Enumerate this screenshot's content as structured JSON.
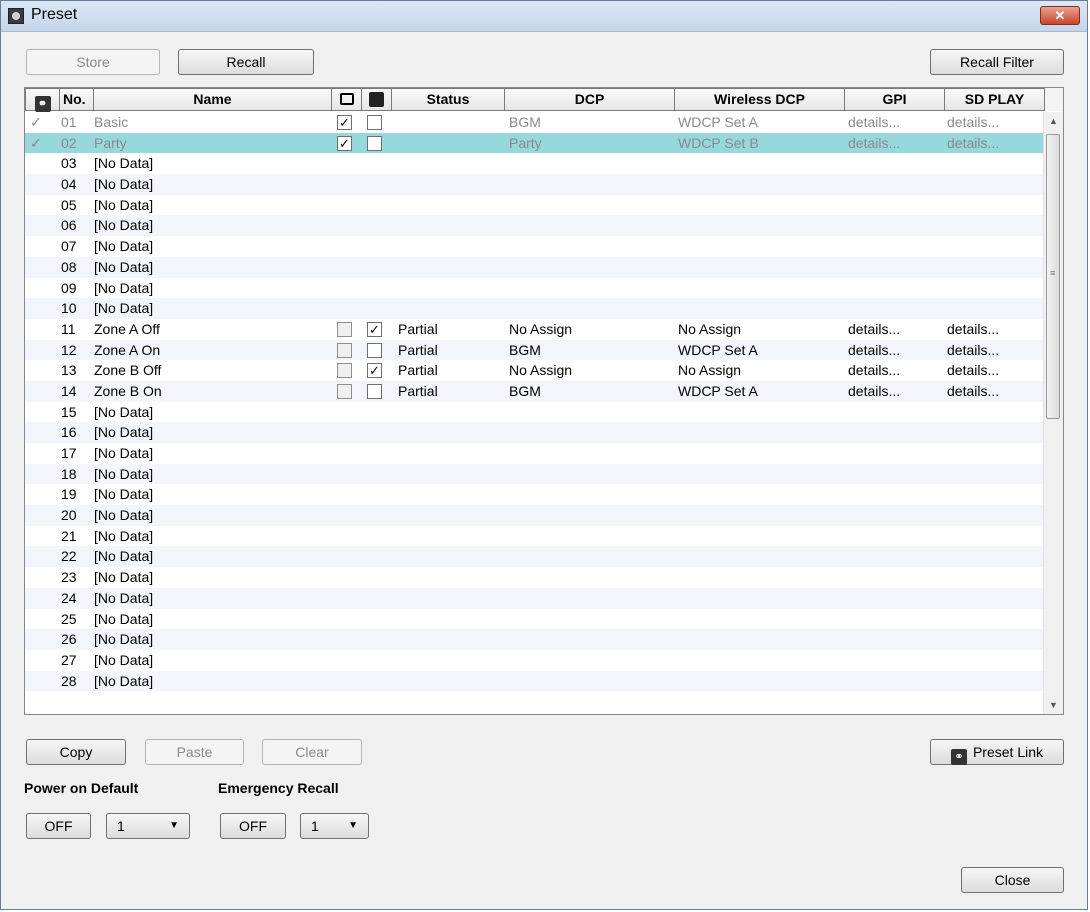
{
  "window": {
    "title": "Preset",
    "close_glyph": "✕"
  },
  "toolbar": {
    "store": "Store",
    "recall": "Recall",
    "recall_filter": "Recall Filter"
  },
  "columns": {
    "link_icon": "link-icon",
    "no": "No.",
    "name": "Name",
    "lock_icon": "lock-icon",
    "clock_icon": "clock-icon",
    "status": "Status",
    "dcp": "DCP",
    "wireless_dcp": "Wireless DCP",
    "gpi": "GPI",
    "sd_play": "SD PLAY"
  },
  "rows": [
    {
      "mark": "✓",
      "no": "01",
      "name": "Basic",
      "lock": true,
      "clock": false,
      "status": "",
      "dcp": "BGM",
      "wdcp": "WDCP Set A",
      "gpi": "details...",
      "sd": "details...",
      "state": "grey"
    },
    {
      "mark": "✓",
      "no": "02",
      "name": "Party",
      "lock": true,
      "clock": false,
      "status": "",
      "dcp": "Party",
      "wdcp": "WDCP Set B",
      "gpi": "details...",
      "sd": "details...",
      "state": "selected"
    },
    {
      "mark": "",
      "no": "03",
      "name": "[No Data]"
    },
    {
      "mark": "",
      "no": "04",
      "name": "[No Data]"
    },
    {
      "mark": "",
      "no": "05",
      "name": "[No Data]"
    },
    {
      "mark": "",
      "no": "06",
      "name": "[No Data]"
    },
    {
      "mark": "",
      "no": "07",
      "name": "[No Data]"
    },
    {
      "mark": "",
      "no": "08",
      "name": "[No Data]"
    },
    {
      "mark": "",
      "no": "09",
      "name": "[No Data]"
    },
    {
      "mark": "",
      "no": "10",
      "name": "[No Data]"
    },
    {
      "mark": "",
      "no": "11",
      "name": "Zone A Off",
      "lock": false,
      "clock": true,
      "status": "Partial",
      "dcp": "No Assign",
      "wdcp": "No Assign",
      "gpi": "details...",
      "sd": "details..."
    },
    {
      "mark": "",
      "no": "12",
      "name": "Zone A On",
      "lock": false,
      "clock": false,
      "status": "Partial",
      "dcp": "BGM",
      "wdcp": "WDCP Set A",
      "gpi": "details...",
      "sd": "details..."
    },
    {
      "mark": "",
      "no": "13",
      "name": "Zone B Off",
      "lock": false,
      "clock": true,
      "status": "Partial",
      "dcp": "No Assign",
      "wdcp": "No Assign",
      "gpi": "details...",
      "sd": "details..."
    },
    {
      "mark": "",
      "no": "14",
      "name": "Zone B On",
      "lock": false,
      "clock": false,
      "status": "Partial",
      "dcp": "BGM",
      "wdcp": "WDCP Set A",
      "gpi": "details...",
      "sd": "details..."
    },
    {
      "mark": "",
      "no": "15",
      "name": "[No Data]"
    },
    {
      "mark": "",
      "no": "16",
      "name": "[No Data]"
    },
    {
      "mark": "",
      "no": "17",
      "name": "[No Data]"
    },
    {
      "mark": "",
      "no": "18",
      "name": "[No Data]"
    },
    {
      "mark": "",
      "no": "19",
      "name": "[No Data]"
    },
    {
      "mark": "",
      "no": "20",
      "name": "[No Data]"
    },
    {
      "mark": "",
      "no": "21",
      "name": "[No Data]"
    },
    {
      "mark": "",
      "no": "22",
      "name": "[No Data]"
    },
    {
      "mark": "",
      "no": "23",
      "name": "[No Data]"
    },
    {
      "mark": "",
      "no": "24",
      "name": "[No Data]"
    },
    {
      "mark": "",
      "no": "25",
      "name": "[No Data]"
    },
    {
      "mark": "",
      "no": "26",
      "name": "[No Data]"
    },
    {
      "mark": "",
      "no": "27",
      "name": "[No Data]"
    },
    {
      "mark": "",
      "no": "28",
      "name": "[No Data]"
    }
  ],
  "actions": {
    "copy": "Copy",
    "paste": "Paste",
    "clear": "Clear",
    "preset_link": "Preset Link"
  },
  "power_on_default": {
    "label": "Power on Default",
    "toggle": "OFF",
    "value": "1",
    "arrow": "▼"
  },
  "emergency_recall": {
    "label": "Emergency Recall",
    "toggle": "OFF",
    "value": "1",
    "arrow": "▼"
  },
  "footer": {
    "close": "Close"
  }
}
